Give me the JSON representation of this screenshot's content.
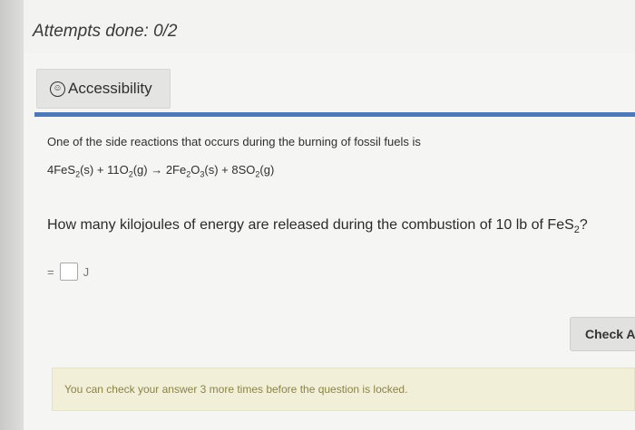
{
  "header": {
    "attempts": "Attempts done: 0/2"
  },
  "accessibility": {
    "label": "Accessibility"
  },
  "problem": {
    "intro": "One of the side reactions that occurs during the burning of fossil fuels is",
    "equation": {
      "t1": "4FeS",
      "t1s": "2",
      "t2": "(s) + 11O",
      "t2s": "2",
      "t3": "(g) → 2Fe",
      "t3s": "2",
      "t4": "O",
      "t4s": "3",
      "t5": "(s) + 8SO",
      "t5s": "2",
      "t6": "(g)"
    },
    "question": {
      "text": "How many kilojoules of energy are released during the combustion of 10 lb of FeS",
      "sub": "2",
      "end": "?"
    }
  },
  "answer": {
    "equals": "=",
    "value": "",
    "unit": "J"
  },
  "check_button": {
    "label": "Check An"
  },
  "notice": {
    "text": "You can check your answer 3 more times before the question is locked."
  }
}
